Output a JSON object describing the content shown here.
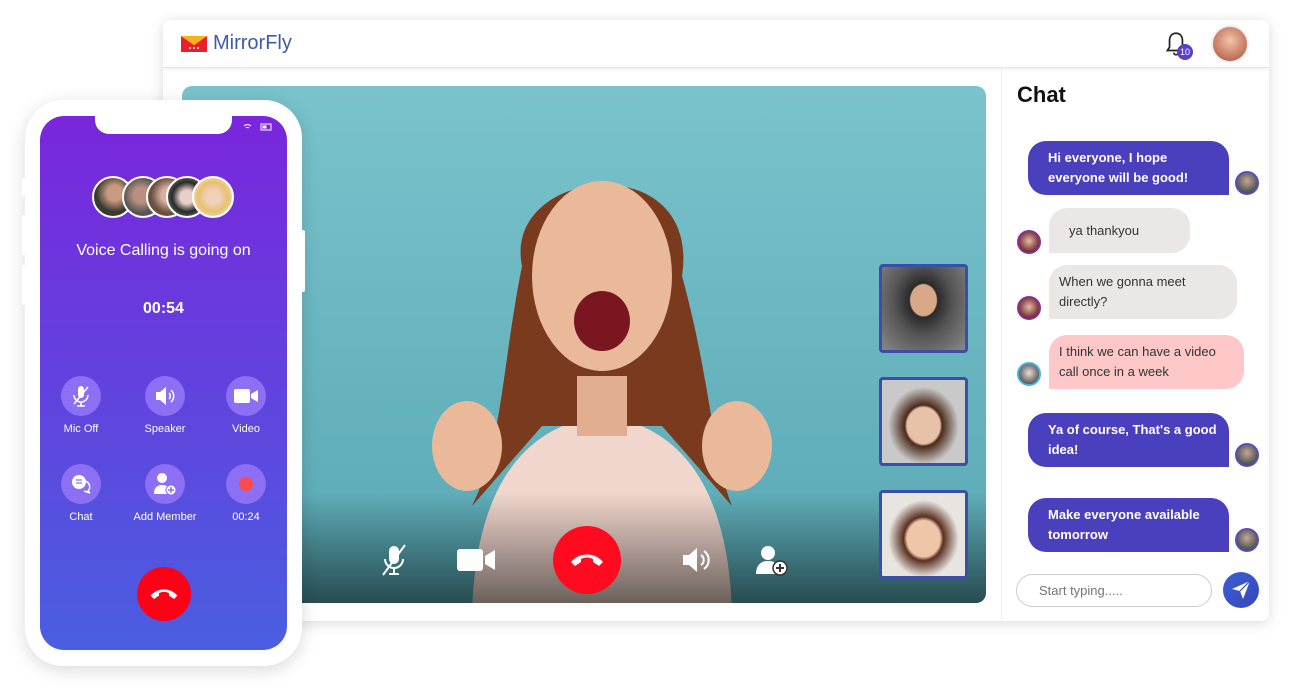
{
  "app": {
    "brand": "MirrorFly",
    "notification_count": "10"
  },
  "video_call": {
    "controls": [
      "mic-off",
      "video",
      "end-call",
      "speaker",
      "add-member"
    ],
    "participants": 3
  },
  "chat": {
    "title": "Chat",
    "messages": [
      {
        "type": "outgoing",
        "text": "Hi everyone, I hope everyone will be good!"
      },
      {
        "type": "incoming",
        "text": "ya thankyou"
      },
      {
        "type": "incoming",
        "text": "When we gonna meet directly?"
      },
      {
        "type": "incoming",
        "text": "I think we can have a video call once in a week"
      },
      {
        "type": "outgoing",
        "text": "Ya of course, That's a good idea!"
      },
      {
        "type": "outgoing",
        "text": "Make everyone available tomorrow"
      }
    ],
    "input_placeholder": "Start typing....."
  },
  "phone": {
    "status": "Voice Calling is going on",
    "timer": "00:54",
    "buttons": [
      {
        "label": "Mic Off",
        "icon": "mic-off-icon"
      },
      {
        "label": "Speaker",
        "icon": "speaker-icon"
      },
      {
        "label": "Video",
        "icon": "video-icon"
      },
      {
        "label": "Chat",
        "icon": "chat-icon"
      },
      {
        "label": "Add Member",
        "icon": "add-member-icon"
      },
      {
        "label": "00:24",
        "icon": "record-icon"
      }
    ]
  },
  "colors": {
    "accent": "#4a3fbd",
    "end_call": "#ff0a1e",
    "incoming_bubble": "#ebe7e7",
    "highlight_bubble": "#ffc8c8"
  }
}
